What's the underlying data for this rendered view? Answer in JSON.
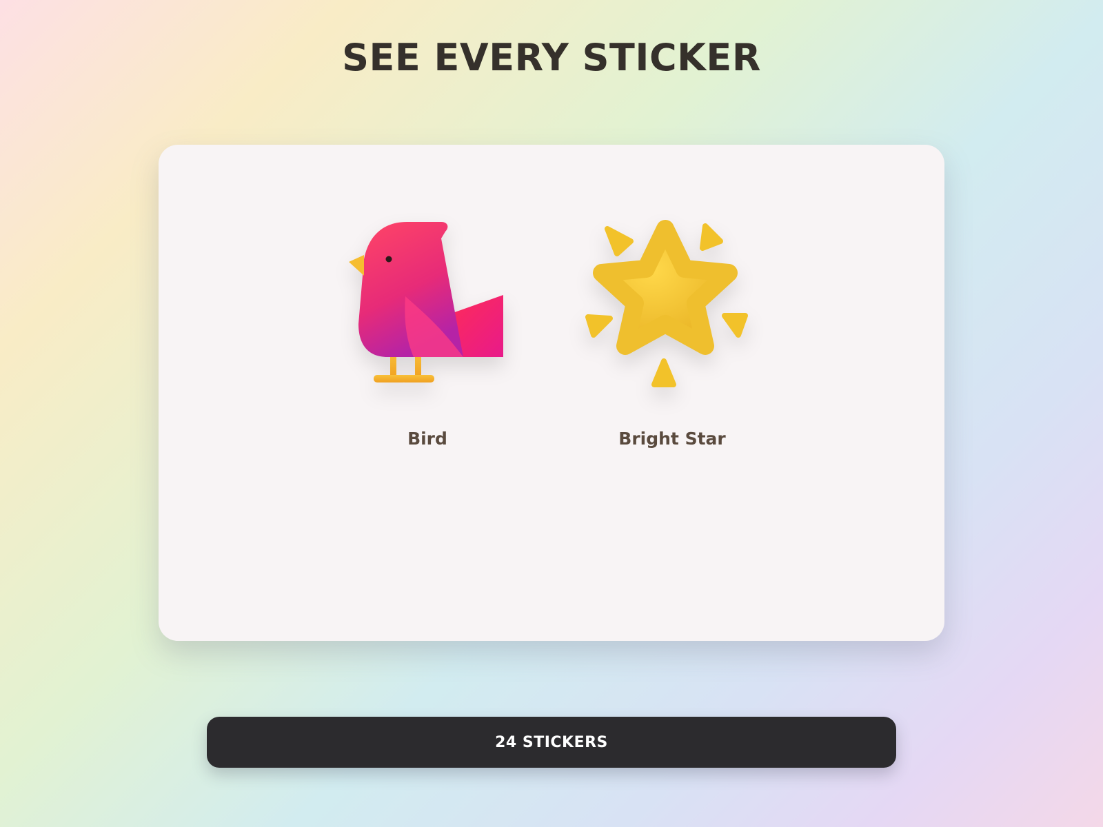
{
  "header": {
    "title": "SEE EVERY STICKER"
  },
  "stickers": [
    {
      "label": "Bird",
      "icon": "bird-icon",
      "color": "#f0306a"
    },
    {
      "label": "Bright Star",
      "icon": "bright-star-icon",
      "color": "#f2c22a"
    }
  ],
  "footer": {
    "count_label": "24 STICKERS"
  }
}
